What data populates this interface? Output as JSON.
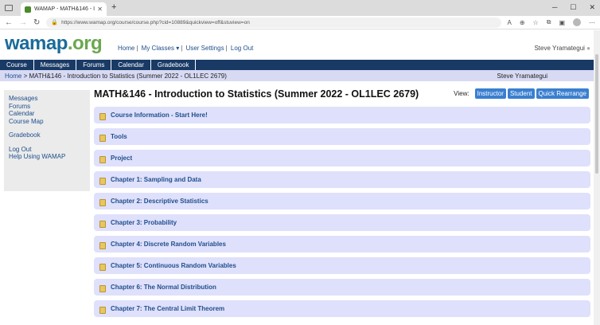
{
  "browser": {
    "tab_title": "WAMAP - MATH&146 - Introdu",
    "url": "https://www.wamap.org/course/course.php?cid=10889&quickview=off&stuview=on"
  },
  "header": {
    "logo_main": "wamap",
    "logo_tld": ".org",
    "links": [
      "Home",
      "My Classes",
      "User Settings",
      "Log Out"
    ],
    "user": "Steve Yramategui"
  },
  "nav": [
    "Course",
    "Messages",
    "Forums",
    "Calendar",
    "Gradebook"
  ],
  "breadcrumb": {
    "home": "Home",
    "current": "> MATH&146 - Introduction to Statistics (Summer 2022 - OL1LEC 2679)",
    "user": "Steve Yramategui"
  },
  "sidebar": {
    "group1": [
      "Messages",
      "Forums",
      "Calendar",
      "Course Map"
    ],
    "group2": [
      "Gradebook"
    ],
    "group3": [
      "Log Out",
      "Help Using WAMAP"
    ]
  },
  "main": {
    "title": "MATH&146 - Introduction to Statistics (Summer 2022 - OL1LEC 2679)",
    "view_label": "View:",
    "view_buttons": [
      "Instructor",
      "Student",
      "Quick Rearrange"
    ],
    "blocks": [
      "Course Information - Start Here!",
      "Tools",
      "Project",
      "Chapter 1: Sampling and Data",
      "Chapter 2: Descriptive Statistics",
      "Chapter 3: Probability",
      "Chapter 4: Discrete Random Variables",
      "Chapter 5: Continuous Random Variables",
      "Chapter 6: The Normal Distribution",
      "Chapter 7: The Central Limit Theorem"
    ]
  }
}
